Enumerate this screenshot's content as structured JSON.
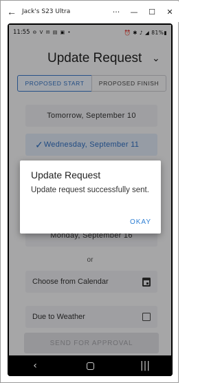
{
  "window": {
    "title": "Jack's S23 Ultra",
    "back_icon": "←",
    "more_icon": "···",
    "minimize_icon": "—",
    "maximize_icon": "☐",
    "close_icon": "✕"
  },
  "statusbar": {
    "time": "11:55",
    "left_icons": "⊖ V ✉ ▤ ▣ •",
    "right_icons": "⏰ ✱ ♪ ◢ 81%▮"
  },
  "header": {
    "title": "Update Request",
    "chevron": "⌄"
  },
  "toggle": {
    "start_label": "PROPOSED START",
    "finish_label": "PROPOSED FINISH",
    "active": "start"
  },
  "options": [
    {
      "label": "Tomorrow, September 10",
      "selected": false
    },
    {
      "label": "Wednesday, September 11",
      "selected": true
    },
    {
      "label": "Monday, September 16",
      "selected": false
    }
  ],
  "check_icon": "✓",
  "or_label": "or",
  "calendar_row": {
    "label": "Choose from Calendar"
  },
  "weather_row": {
    "label": "Due to Weather",
    "checked": false
  },
  "send_button": {
    "label": "SEND FOR APPROVAL",
    "disabled": true
  },
  "dialog": {
    "title": "Update Request",
    "message": "Update request successfully sent.",
    "ok_label": "OKAY"
  },
  "navbar": {
    "back_icon": "‹",
    "recents_icon": "|||"
  }
}
